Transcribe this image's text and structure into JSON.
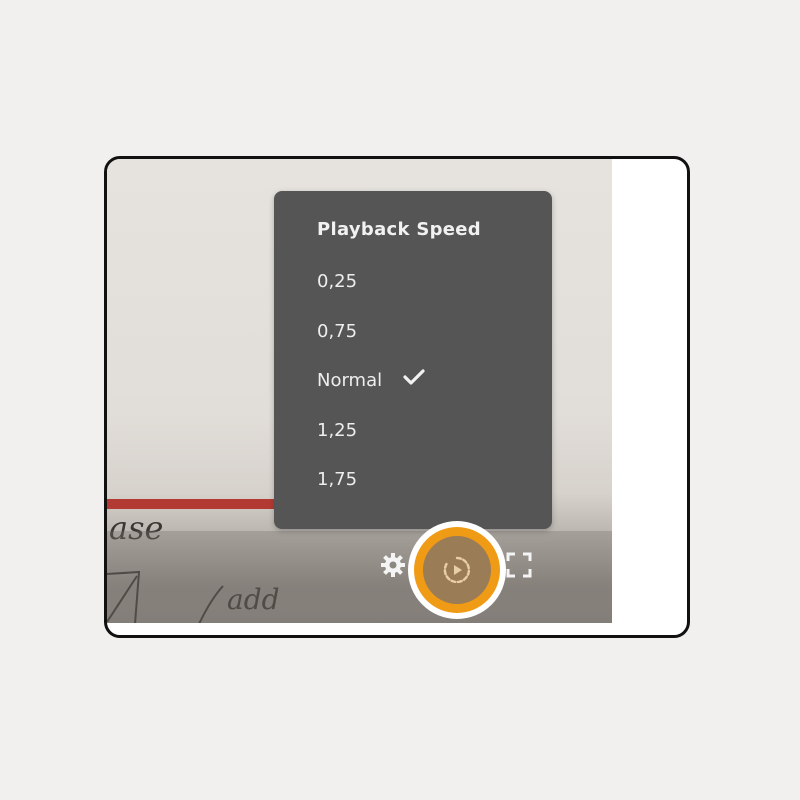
{
  "menu": {
    "title": "Playback Speed",
    "items": [
      {
        "label": "0,25",
        "selected": false
      },
      {
        "label": "0,75",
        "selected": false
      },
      {
        "label": "Normal",
        "selected": true
      },
      {
        "label": "1,25",
        "selected": false
      },
      {
        "label": "1,75",
        "selected": false
      }
    ]
  },
  "video": {
    "progress_fraction": 0.4,
    "whiteboard_text": [
      "ase",
      "add"
    ]
  },
  "controls": {
    "icons": [
      "gear-icon",
      "playback-speed-icon",
      "fullscreen-icon"
    ]
  },
  "colors": {
    "menu_background": "#555555",
    "progress": "#b33a33",
    "highlight_ring": "#f09b16",
    "highlight_border": "#ffffff",
    "frame_border": "#111111"
  }
}
